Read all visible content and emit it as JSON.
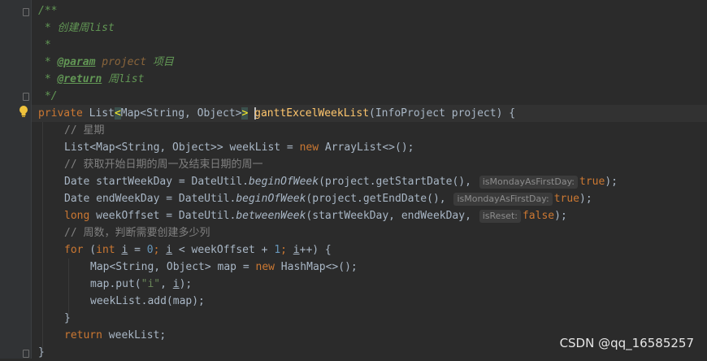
{
  "code": {
    "doc_open": "/**",
    "doc_desc": " * 创建周list",
    "doc_blank": " *",
    "doc_param_tag": "@param",
    "doc_param_name": "project",
    "doc_param_desc": "项目",
    "doc_return_tag": "@return",
    "doc_return_desc": "周list",
    "doc_close": " */",
    "method_signature_kw": "private",
    "method_return_type_a": "List",
    "method_return_lt": "<",
    "method_return_inner": "Map<String, Object>",
    "method_return_gt": ">",
    "method_name": "ganttExcelWeekList",
    "method_params": "(InfoProject project) {",
    "comment_week": "// 星期",
    "line_weeklist_decl_a": "List<Map<String, Object>> weekList = ",
    "kw_new": "new",
    "line_weeklist_decl_b": " ArrayList<>();",
    "comment_get_dates": "// 获取开始日期的周一及结束日期的周一",
    "line_start_a": "Date startWeekDay = DateUtil.",
    "line_start_call": "beginOfWeek",
    "line_start_b": "(project.getStartDate(), ",
    "hint_monday": "isMondayAsFirstDay:",
    "kw_true": "true",
    "line_end_a": "Date endWeekDay = DateUtil.",
    "line_end_b": "(project.getEndDate(), ",
    "kw_long": "long",
    "line_offset_a": " weekOffset = DateUtil.",
    "line_offset_call": "betweenWeek",
    "line_offset_b": "(startWeekDay, endWeekDay, ",
    "hint_reset": "isReset:",
    "kw_false": "false",
    "comment_weeks": "// 周数，判断需要创建多少列",
    "kw_for": "for",
    "kw_int": "int",
    "var_i": "i",
    "for_eq": " = ",
    "num_zero": "0",
    "for_lt": " < weekOffset + ",
    "num_one": "1",
    "for_inc": "++) {",
    "line_map_a": "Map<String, Object> map = ",
    "line_map_b": " HashMap<>();",
    "line_put_a": "map.put(",
    "str_i": "\"i\"",
    "line_put_b": ", ",
    "line_put_c": ");",
    "line_add": "weekList.add(map);",
    "close_brace": "}",
    "kw_return": "return",
    "line_return_b": " weekList;"
  },
  "watermark": "CSDN @qq_16585257",
  "colors": {
    "background": "#2b2b2b",
    "keyword": "#cc7832",
    "method": "#ffc66d",
    "number": "#6897bb",
    "doc": "#629755"
  }
}
